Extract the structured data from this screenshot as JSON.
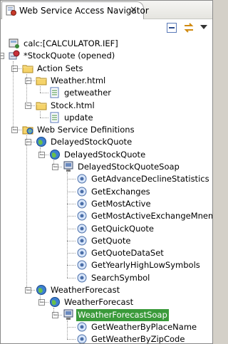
{
  "view": {
    "title": "Web Service Access Navigator"
  },
  "tree": [
    {
      "label": "calc:[CALCULATOR.IEF]",
      "icon": "calc-connection-icon",
      "depth": 0,
      "toggle": null
    },
    {
      "label": "*StockQuote (opened)",
      "icon": "project-icon",
      "depth": 0,
      "toggle": "-"
    },
    {
      "label": "Action Sets",
      "icon": "folder-icon",
      "depth": 1,
      "toggle": "-"
    },
    {
      "label": "Weather.html",
      "icon": "folder-icon",
      "depth": 2,
      "toggle": "-"
    },
    {
      "label": "getweather",
      "icon": "action-icon",
      "depth": 3,
      "toggle": null
    },
    {
      "label": "Stock.html",
      "icon": "folder-icon",
      "depth": 2,
      "toggle": "-"
    },
    {
      "label": "update",
      "icon": "action-icon",
      "depth": 3,
      "toggle": null
    },
    {
      "label": "Web Service Definitions",
      "icon": "web-folder-icon",
      "depth": 1,
      "toggle": "-"
    },
    {
      "label": "DelayedStockQuote",
      "icon": "web-service-icon",
      "depth": 2,
      "toggle": "-"
    },
    {
      "label": "DelayedStockQuote",
      "icon": "web-service-icon",
      "depth": 3,
      "toggle": "-"
    },
    {
      "label": "DelayedStockQuoteSoap",
      "icon": "port-icon",
      "depth": 4,
      "toggle": "-"
    },
    {
      "label": "GetAdvanceDeclineStatistics",
      "icon": "operation-icon",
      "depth": 5,
      "toggle": null
    },
    {
      "label": "GetExchanges",
      "icon": "operation-icon",
      "depth": 5,
      "toggle": null
    },
    {
      "label": "GetMostActive",
      "icon": "operation-icon",
      "depth": 5,
      "toggle": null
    },
    {
      "label": "GetMostActiveExchangeMnemon",
      "icon": "operation-icon",
      "depth": 5,
      "toggle": null
    },
    {
      "label": "GetQuickQuote",
      "icon": "operation-icon",
      "depth": 5,
      "toggle": null
    },
    {
      "label": "GetQuote",
      "icon": "operation-icon",
      "depth": 5,
      "toggle": null
    },
    {
      "label": "GetQuoteDataSet",
      "icon": "operation-icon",
      "depth": 5,
      "toggle": null
    },
    {
      "label": "GetYearlyHighLowSymbols",
      "icon": "operation-icon",
      "depth": 5,
      "toggle": null
    },
    {
      "label": "SearchSymbol",
      "icon": "operation-icon",
      "depth": 5,
      "toggle": null
    },
    {
      "label": "WeatherForecast",
      "icon": "web-service-icon",
      "depth": 2,
      "toggle": "-"
    },
    {
      "label": "WeatherForecast",
      "icon": "web-service-icon",
      "depth": 3,
      "toggle": "-"
    },
    {
      "label": "WeatherForecastSoap",
      "icon": "port-icon",
      "depth": 4,
      "toggle": "-",
      "selected": true
    },
    {
      "label": "GetWeatherByPlaceName",
      "icon": "operation-icon",
      "depth": 5,
      "toggle": null
    },
    {
      "label": "GetWeatherByZipCode",
      "icon": "operation-icon",
      "depth": 5,
      "toggle": null
    }
  ]
}
